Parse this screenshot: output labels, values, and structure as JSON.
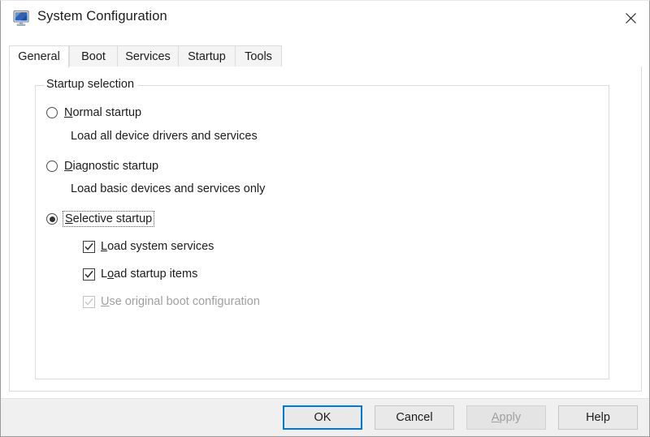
{
  "window": {
    "title": "System Configuration",
    "icon": "system-configuration-monitor-icon",
    "close_label": "×"
  },
  "tabs": [
    {
      "label": "General",
      "active": true
    },
    {
      "label": "Boot",
      "active": false
    },
    {
      "label": "Services",
      "active": false
    },
    {
      "label": "Startup",
      "active": false
    },
    {
      "label": "Tools",
      "active": false
    }
  ],
  "general": {
    "group_label": "Startup selection",
    "options": [
      {
        "label_pre": "",
        "label_key": "N",
        "label_post": "ormal startup",
        "full_label": "Normal startup",
        "selected": false,
        "focused": false,
        "hint": "Load all device drivers and services"
      },
      {
        "label_pre": "",
        "label_key": "D",
        "label_post": "iagnostic startup",
        "full_label": "Diagnostic startup",
        "selected": false,
        "focused": false,
        "hint": "Load basic devices and services only"
      },
      {
        "label_pre": "",
        "label_key": "S",
        "label_post": "elective startup",
        "full_label": "Selective startup",
        "selected": true,
        "focused": true,
        "hint": ""
      }
    ],
    "checkboxes": [
      {
        "label_pre": "",
        "label_key": "L",
        "label_post": "oad system services",
        "full_label": "Load system services",
        "checked": true,
        "disabled": false
      },
      {
        "label_pre": "L",
        "label_key": "o",
        "label_post": "ad startup items",
        "full_label": "Load startup items",
        "checked": true,
        "disabled": false
      },
      {
        "label_pre": "",
        "label_key": "U",
        "label_post": "se original boot configuration",
        "full_label": "Use original boot configuration",
        "checked": true,
        "disabled": true
      }
    ]
  },
  "footer": {
    "buttons": [
      {
        "label": "OK",
        "default": true,
        "disabled": false,
        "key": ""
      },
      {
        "label": "Cancel",
        "default": false,
        "disabled": false,
        "key": ""
      },
      {
        "label_pre": "",
        "key": "A",
        "label_post": "pply",
        "label": "Apply",
        "default": false,
        "disabled": true
      },
      {
        "label": "Help",
        "default": false,
        "disabled": false,
        "key": ""
      }
    ]
  },
  "colors": {
    "accent": "#0078d7",
    "footer_bg": "#f0f0f0",
    "panel_bg": "#ffffff",
    "border": "#dcdcdc",
    "disabled_text": "#a0a0a0"
  }
}
